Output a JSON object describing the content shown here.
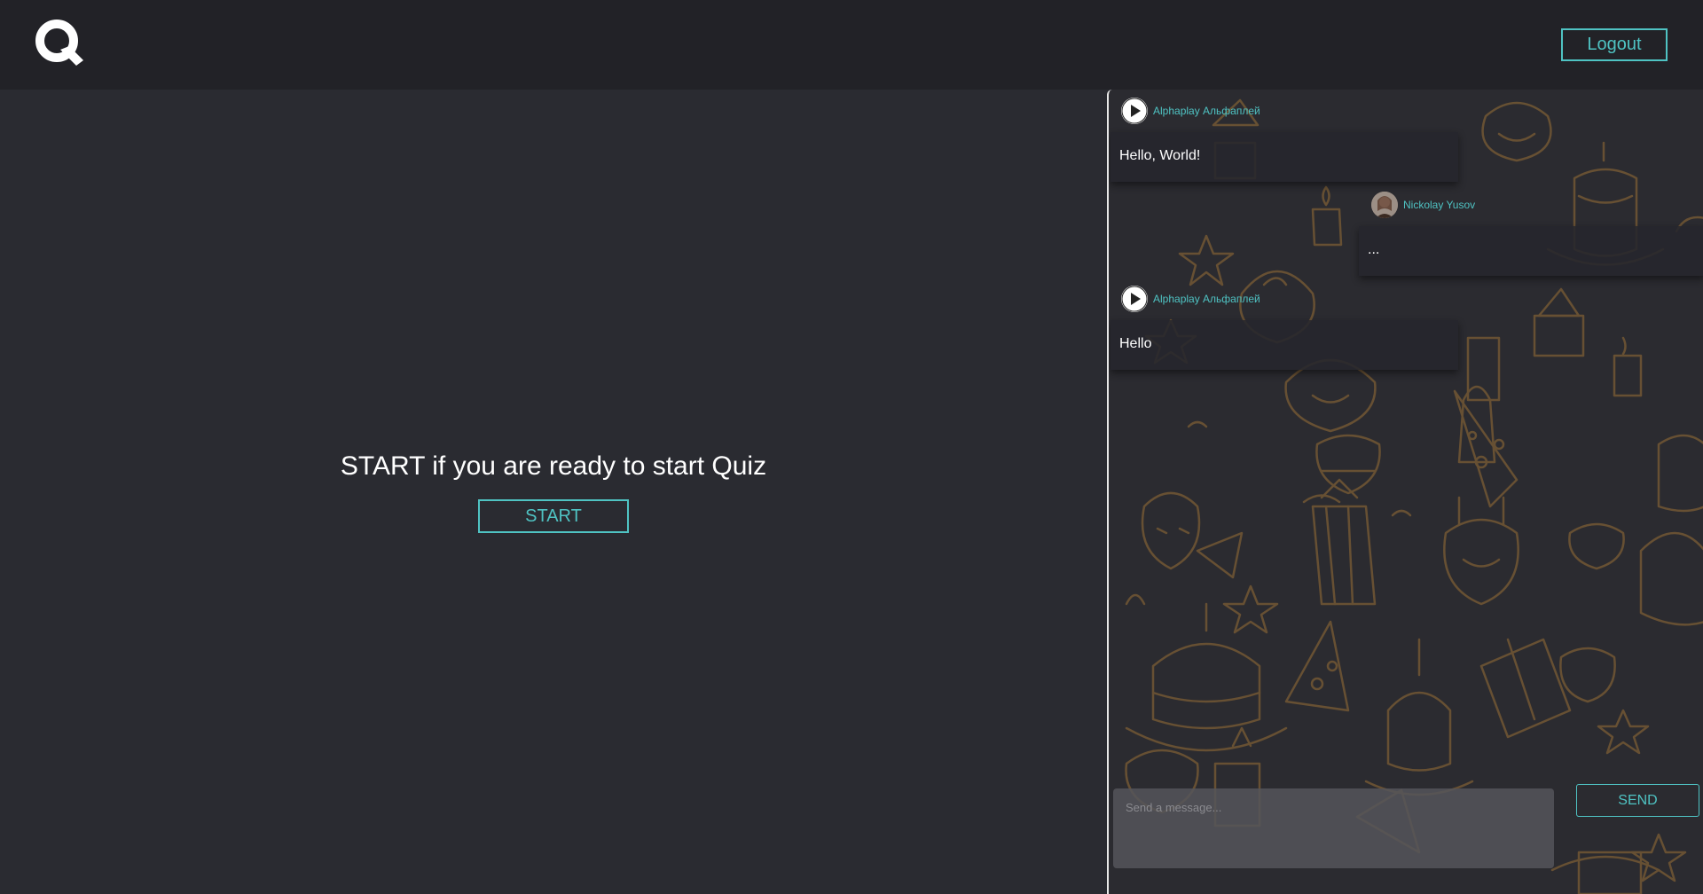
{
  "header": {
    "logo_icon": "q-logo-icon",
    "logout_label": "Logout"
  },
  "main": {
    "prompt": "START if you are ready to start Quiz",
    "start_label": "START"
  },
  "chat": {
    "messages": [
      {
        "sender": "Alphaplay Альфаплей",
        "text": "Hello, World!",
        "avatar_icon": "alphaplay-logo-icon"
      },
      {
        "sender": "Nickolay Yusov",
        "text": "...",
        "avatar_icon": "user-photo-avatar"
      },
      {
        "sender": "Alphaplay Альфаплей",
        "text": "Hello",
        "avatar_icon": "alphaplay-logo-icon"
      }
    ],
    "input_placeholder": "Send a message...",
    "send_label": "SEND"
  },
  "colors": {
    "accent": "#4fc3c3",
    "header_bg": "#222227",
    "page_bg": "#2a2b31",
    "chat_pattern": "#6e5534"
  }
}
